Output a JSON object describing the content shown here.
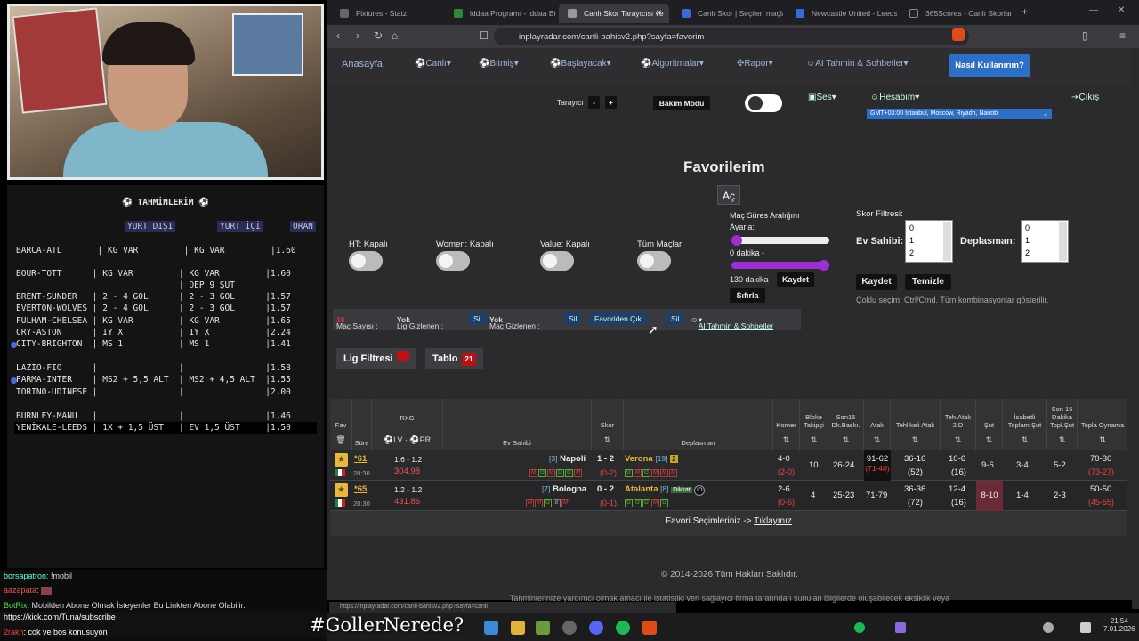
{
  "stream": {
    "tahmin_title": "TAHMİNLERİM",
    "col_yurt_disi": "YURT DIŞI",
    "col_yurt_ici": "YURT İÇİ",
    "col_oran": "ORAN",
    "rows": [
      "BARCA-ATL       | KG VAR         | KG VAR         |1.60",
      "BOUR-TOTT      | KG VAR         | KG VAR         |1.60",
      "                                | DEP 9 ŞUT",
      "BRENT-SUNDER   | 2 - 4 GOL      | 2 - 3 GOL      |1.57",
      "EVERTON-WOLVES | 2 - 4 GOL      | 2 - 3 GOL      |1.57",
      "FULHAM-CHELSEA | KG VAR         | KG VAR         |1.65",
      "CRY-ASTON      | IY X           | IY X           |2.24",
      "CITY-BRIGHTON  | MS 1           | MS 1           |1.41",
      "LAZIO-FIO      |                |                |1.58",
      "PARMA-INTER    | MS2 + 5,5 ALT  | MS2 + 4,5 ALT  |1.55",
      "TORINO-UDINESE |                |                |2.00",
      "BURNLEY-MANU   |                |                |1.46",
      "YENİKALE-LEEDS | 1X + 1,5 ÜST   | EV 1,5 ÜST     |1.50"
    ],
    "chat": [
      {
        "user": "borsapatron",
        "msg": ": !mobil"
      },
      {
        "user": "aazapata",
        "msg": ":"
      },
      {
        "user": "BotRix",
        "msg": ": Mobilden Abone Olmak İsteyenler Bu Linkten Abone Olabilir."
      },
      {
        "user": "",
        "msg": "https://kick.com/Tuna/subscribe"
      },
      {
        "user": "2rakn",
        "msg": ": cok ve bos konusuyon"
      }
    ],
    "overlay_text": "#GollerNerede?"
  },
  "browser": {
    "tabs": [
      "Fixtures - Statz",
      "iddaa Programı - iddaa Bü",
      "Canlı Skor Tarayıcısı ve",
      "Canlı Skor | Seçilen maçlar",
      "Newcastle United - Leeds",
      "365Scores - Canlı Skorlar,"
    ],
    "url": "inplayradar.com/canli-bahisv2.php?sayfa=favorim",
    "status_url": "https://inplayradar.com/canli-bahisv2.php?sayfa=canli"
  },
  "menu": {
    "items": [
      "Anasayfa",
      "Canlı",
      "Bitmiş",
      "Başlayacak",
      "Algoritmalar",
      "Rapor",
      "AI Tahmin & Sohbetler"
    ],
    "help": "Nasıl Kullanırım?",
    "tarayici": "Tarayıcı",
    "minus": "-",
    "plus": "+",
    "bakim": "Bakım Modu",
    "ses": "Ses",
    "hesabim": "Hesabım",
    "cikis": "Çıkış",
    "timezone": "GMT+03:00 Istanbul, Moscow, Riyadh, Nairobi"
  },
  "favorites": {
    "title": "Favorilerim",
    "ac": "Aç",
    "toggles": [
      "HT: Kapalı",
      "Women: Kapalı",
      "Value: Kapalı",
      "Tüm Maçlar"
    ],
    "range_label": "Maç Süres Aralığını Ayarla:",
    "min_label": "0 dakika -",
    "max_label": "130 dakika",
    "kaydet": "Kaydet",
    "sifirla": "Sıfırla",
    "skor_filtresi": "Skor Filtresi:",
    "ev_sahibi": "Ev Sahibi:",
    "deplasman": "Deplasman:",
    "list_values": [
      "0",
      "1",
      "2"
    ],
    "kaydet2": "Kaydet",
    "temizle": "Temizle",
    "hint": "Çoklu seçim: Ctrl/Cmd. Tüm kombinasyonlar gösterilir."
  },
  "actions": {
    "mac_sayisi": "Maç Sayısı :",
    "mac_count": "16",
    "lig_gizlenen": "Lig Gizlenen :",
    "yok1": "Yok",
    "sil": "Sil",
    "mac_gizlenen": "Maç Gizlenen :",
    "yok2": "Yok",
    "favoriden_cik": "Favoriden Çık",
    "ai": "AI Tahmin & Sohbetler",
    "lig_filtresi": "Lig Filtresi",
    "tablo": "Tablo",
    "tablo_count": "21"
  },
  "table": {
    "headers": [
      "Fav",
      "Süre",
      "RXG",
      "Ev Sahibi",
      "Skor",
      "Deplasman",
      "Korner",
      "Bloke Takipçi",
      "Son15 Dk.Baskı.",
      "Atak",
      "Tehlikeli Atak",
      "Teh.Atak 2.D",
      "Şut",
      "İsabetli Toplam Şut",
      "Son 15 Dakika Topl.Şut",
      "Topla Oynama"
    ],
    "lv": "LV",
    "pr": "PR",
    "matches": [
      {
        "minute": "*61",
        "time": "20:30",
        "rxg": "1.6 - 1.2",
        "rxg2": "304.98",
        "home_rank": "[3]",
        "home": "Napoli",
        "score": "1 - 2",
        "ht": "(0-2)",
        "away": "Verona",
        "away_rank": "[19]",
        "away_badge": "2",
        "korner": "4-0",
        "korner2": "(2-0)",
        "bloke": "10",
        "son15": "26-24",
        "atak": "91-62",
        "atak2": "(71-40)",
        "teh": "36-16",
        "teh2": "(52)",
        "teh2d": "10-6",
        "teh2d2": "(16)",
        "sut": "9-6",
        "isabet": "3-4",
        "son15sut": "5-2",
        "topla": "70-30",
        "topla2": "(73-27)",
        "form_h": [
          "M",
          "G",
          "M",
          "G",
          "G",
          "M"
        ],
        "form_a": [
          "G",
          "M",
          "G",
          "M",
          "M",
          "M"
        ]
      },
      {
        "minute": "*65",
        "time": "20:30",
        "rxg": "1.2 - 1.2",
        "rxg2": "431.86",
        "home_rank": "[7]",
        "home": "Bologna",
        "score": "0 - 2",
        "ht": "(0-1)",
        "away": "Atalanta",
        "away_rank": "[8]",
        "away_badge": "Dikkat",
        "korner": "2-6",
        "korner2": "(0-6)",
        "bloke": "4",
        "son15": "25-23",
        "atak": "71-79",
        "atak2": "",
        "teh": "36-36",
        "teh2": "(72)",
        "teh2d": "12-4",
        "teh2d2": "(16)",
        "sut": "8-10",
        "isabet": "1-4",
        "son15sut": "2-3",
        "topla": "50-50",
        "topla2": "(45-55)",
        "form_h": [
          "M",
          "M",
          "G",
          "B",
          "M"
        ],
        "form_a": [
          "G",
          "G",
          "G",
          "M",
          "G"
        ]
      }
    ],
    "footer_text": "Favori Seçimleriniz ->",
    "footer_link": "Tıklayınız"
  },
  "footer": {
    "copyright": "© 2014-2026 Tüm Hakları Saklıdır.",
    "disclaimer": "Tahminlerinize yardımcı olmak amacı ile istatistiki veri sağlayıcı firma tarafından sunulan bilgilerde oluşabilecek eksiklik veya"
  },
  "clock": {
    "time": "21:54",
    "date": "7.01.2026"
  }
}
